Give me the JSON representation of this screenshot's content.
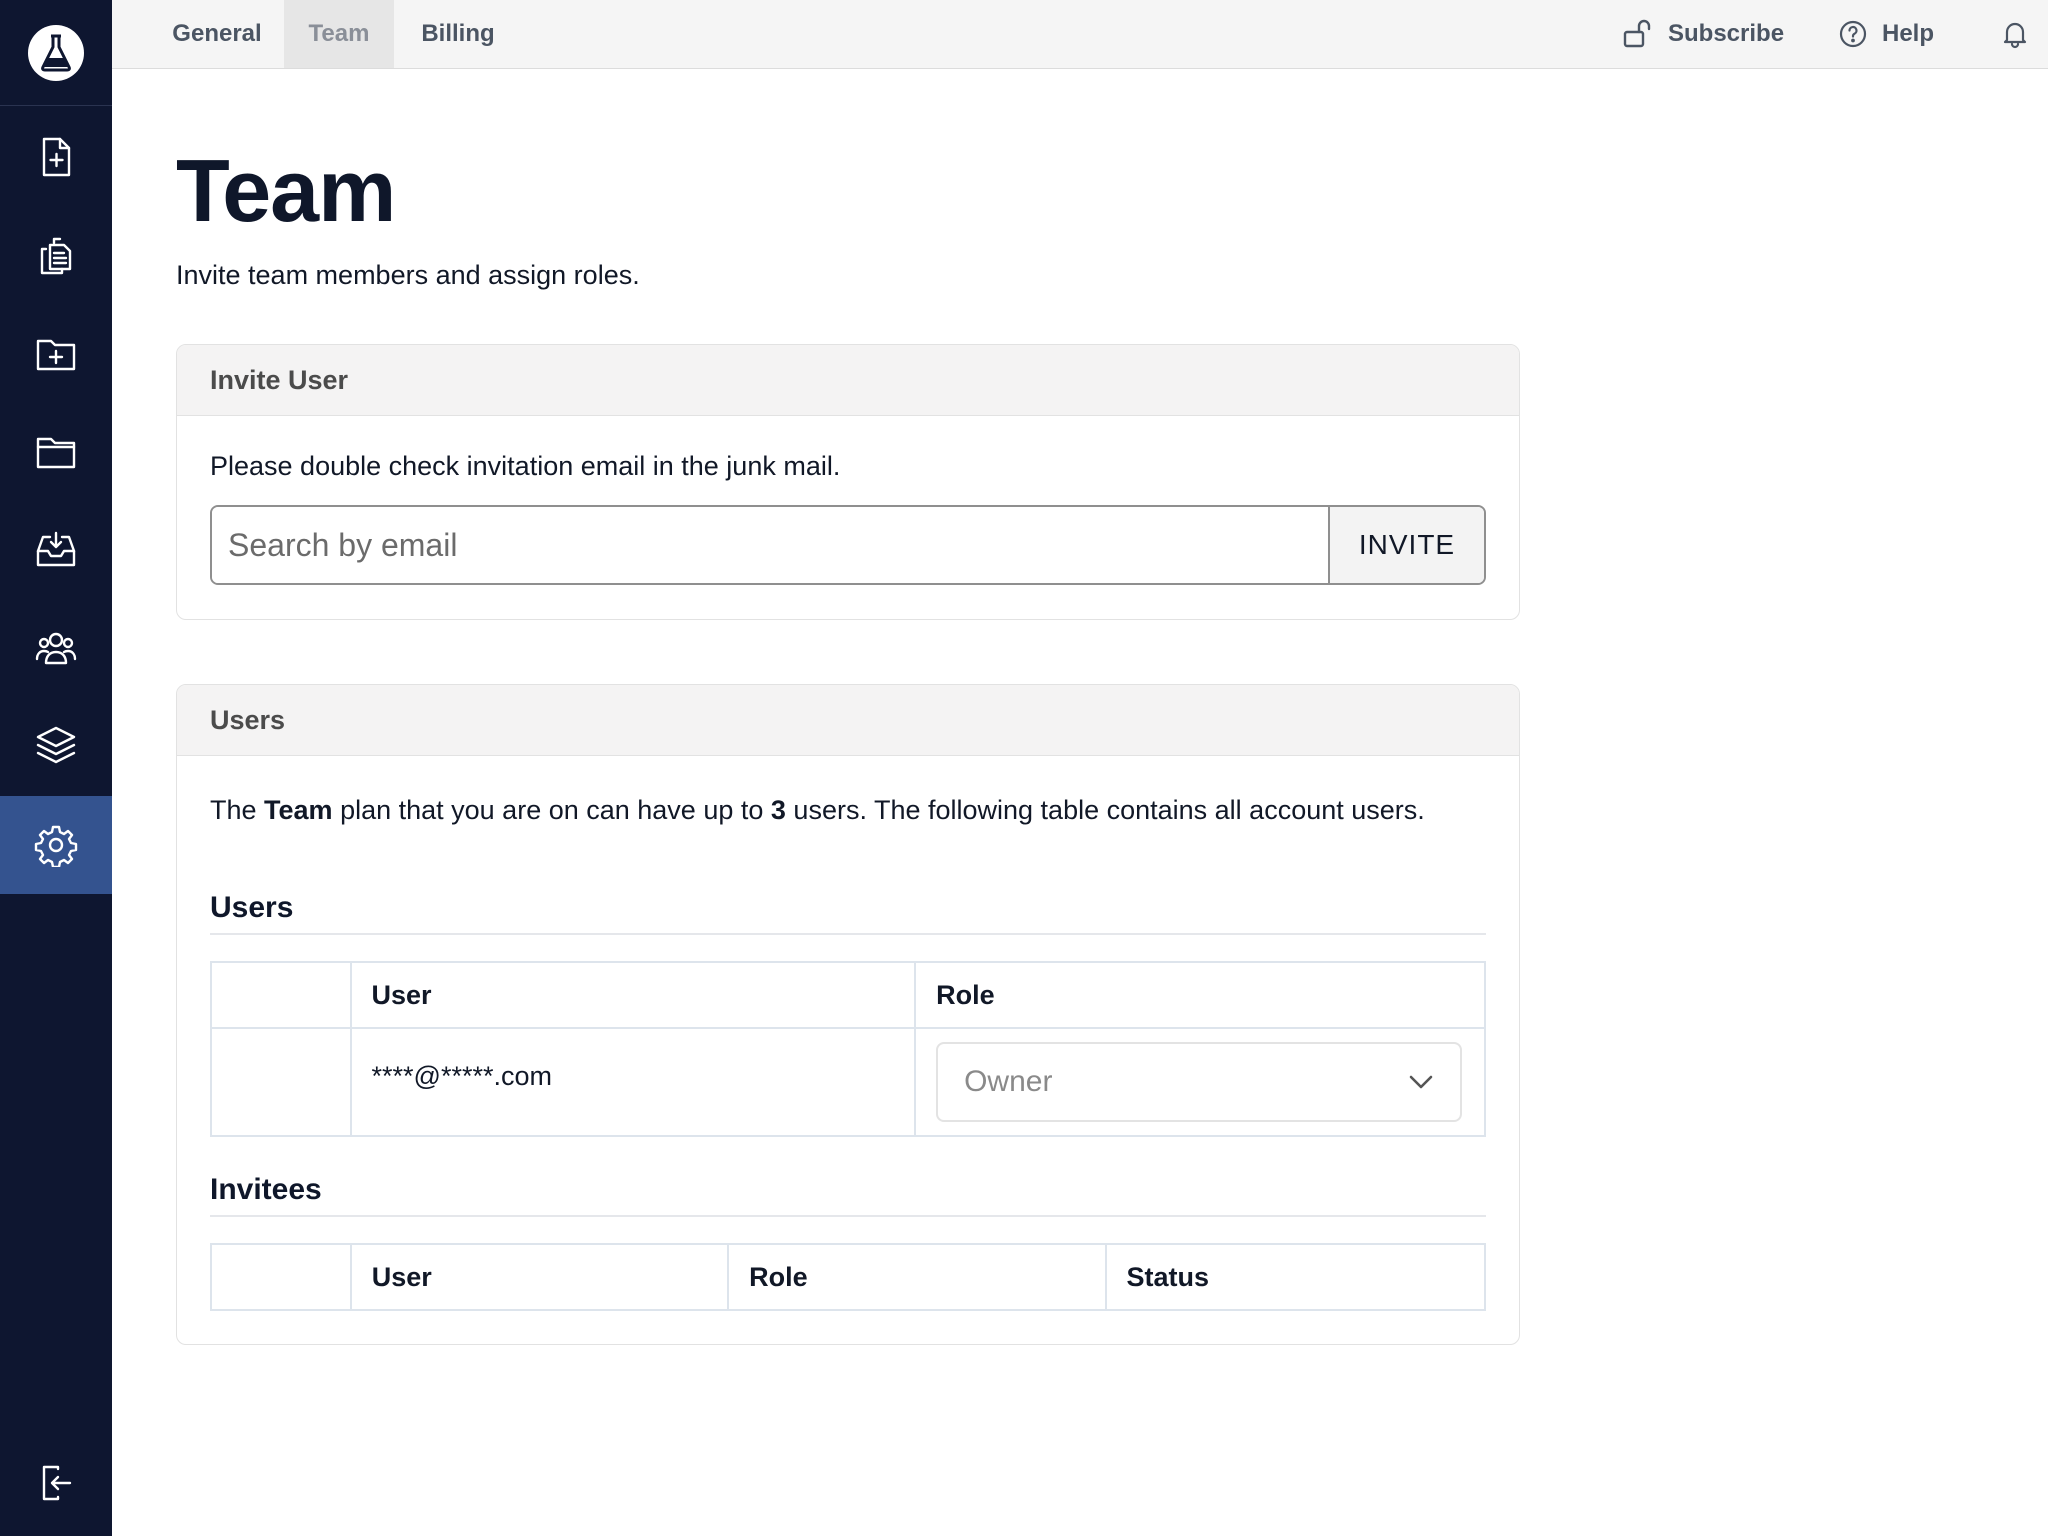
{
  "sidebar": {
    "logo": "flask-logo",
    "items": [
      {
        "icon": "file-plus-icon",
        "active": false
      },
      {
        "icon": "clipboard-copy-icon",
        "active": false
      },
      {
        "icon": "folder-plus-icon",
        "active": false
      },
      {
        "icon": "folder-icon",
        "active": false
      },
      {
        "icon": "inbox-download-icon",
        "active": false
      },
      {
        "icon": "team-users-icon",
        "active": false
      },
      {
        "icon": "layers-icon",
        "active": false
      },
      {
        "icon": "gear-icon",
        "active": true
      }
    ],
    "logout_icon": "logout-icon"
  },
  "topbar": {
    "tabs": [
      {
        "label": "General",
        "active": false
      },
      {
        "label": "Team",
        "active": true
      },
      {
        "label": "Billing",
        "active": false
      }
    ],
    "subscribe_label": "Subscribe",
    "help_label": "Help"
  },
  "page": {
    "title": "Team",
    "subtitle": "Invite team members and assign roles."
  },
  "invite_card": {
    "header": "Invite User",
    "note": "Please double check invitation email in the junk mail.",
    "input_placeholder": "Search by email",
    "input_value": "",
    "button_label": "INVITE"
  },
  "users_card": {
    "header": "Users",
    "plan_text": {
      "prefix": "The ",
      "plan_name": "Team",
      "middle": " plan that you are on can have up to ",
      "limit": "3",
      "suffix": " users. The following table contains all account users."
    },
    "users_heading": "Users",
    "users_columns": [
      "",
      "User",
      "Role"
    ],
    "users_rows": [
      {
        "user": "****@*****.com",
        "role": "Owner"
      }
    ],
    "invitees_heading": "Invitees",
    "invitees_columns": [
      "",
      "User",
      "Role",
      "Status"
    ]
  },
  "colors": {
    "sidebar_bg": "#0e1630",
    "sidebar_active": "#34538f",
    "topbar_bg": "#f5f5f5"
  }
}
